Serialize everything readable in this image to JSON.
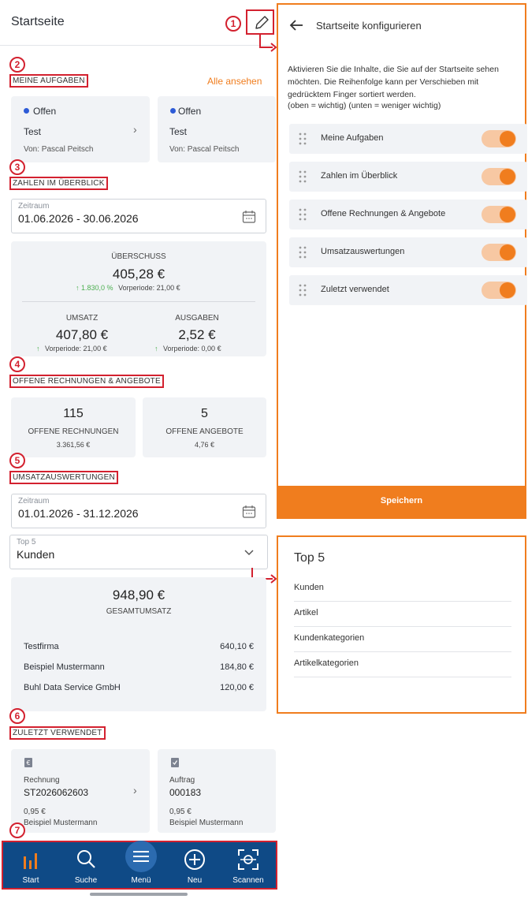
{
  "header": {
    "title": "Startseite"
  },
  "badges": [
    "1",
    "2",
    "3",
    "4",
    "5",
    "6",
    "7"
  ],
  "tasks": {
    "title": "MEINE AUFGABEN",
    "link": "Alle ansehen",
    "cards": [
      {
        "status": "Offen",
        "name": "Test",
        "from": "Von: Pascal Peitsch"
      },
      {
        "status": "Offen",
        "name": "Test",
        "from": "Von: Pascal Peitsch"
      }
    ]
  },
  "overview": {
    "title": "ZAHLEN IM ÜBERBLICK",
    "period_label": "Zeitraum",
    "period_value": "01.06.2026 - 30.06.2026",
    "surplus_label": "ÜBERSCHUSS",
    "surplus_value": "405,28 €",
    "surplus_change": "1.830,0 %",
    "surplus_prev": "Vorperiode: 21,00 €",
    "revenue_label": "UMSATZ",
    "revenue_value": "407,80 €",
    "revenue_prev": "Vorperiode: 21,00 €",
    "expenses_label": "AUSGABEN",
    "expenses_value": "2,52 €",
    "expenses_prev": "Vorperiode: 0,00 €"
  },
  "open_items": {
    "title": "OFFENE RECHNUNGEN & ANGEBOTE",
    "invoices_count": "115",
    "invoices_label": "OFFENE RECHNUNGEN",
    "invoices_sum": "3.361,56 €",
    "offers_count": "5",
    "offers_label": "OFFENE ANGEBOTE",
    "offers_sum": "4,76 €"
  },
  "sales": {
    "title": "UMSATZAUSWERTUNGEN",
    "period_label": "Zeitraum",
    "period_value": "01.01.2026 - 31.12.2026",
    "top_label": "Top 5",
    "top_value": "Kunden",
    "total_value": "948,90 €",
    "total_label": "GESAMTUMSATZ",
    "rows": [
      {
        "name": "Testfirma",
        "amount": "640,10 €"
      },
      {
        "name": "Beispiel Mustermann",
        "amount": "184,80 €"
      },
      {
        "name": "Buhl Data Service GmbH",
        "amount": "120,00 €"
      }
    ]
  },
  "recent": {
    "title": "ZULETZT VERWENDET",
    "cards": [
      {
        "type": "Rechnung",
        "number": "ST2026062603",
        "amount": "0,95 €",
        "customer": "Beispiel Mustermann"
      },
      {
        "type": "Auftrag",
        "number": "000183",
        "amount": "0,95 €",
        "customer": "Beispiel Mustermann"
      }
    ]
  },
  "bottom_nav": {
    "items": [
      {
        "label": "Start"
      },
      {
        "label": "Suche"
      },
      {
        "label": "Menü"
      },
      {
        "label": "Neu"
      },
      {
        "label": "Scannen"
      }
    ]
  },
  "config_panel": {
    "title": "Startseite konfigurieren",
    "description": "Aktivieren Sie die Inhalte, die Sie auf der Startseite sehen möchten. Die Reihenfolge kann per Verschieben mit gedrücktem Finger sortiert werden.",
    "hint": "(oben = wichtig) (unten = weniger wichtig)",
    "toggles": [
      {
        "label": "Meine Aufgaben",
        "on": true
      },
      {
        "label": "Zahlen im Überblick",
        "on": true
      },
      {
        "label": "Offene Rechnungen & Angebote",
        "on": true
      },
      {
        "label": "Umsatzauswertungen",
        "on": true
      },
      {
        "label": "Zuletzt verwendet",
        "on": true
      }
    ],
    "save_label": "Speichern"
  },
  "top5_panel": {
    "title": "Top 5",
    "options": [
      "Kunden",
      "Artikel",
      "Kundenkategorien",
      "Artikelkategorien"
    ]
  },
  "colors": {
    "accent": "#f07d1e",
    "highlight": "#d3212f",
    "nav": "#0f4a86",
    "positive": "#4caf50",
    "status_dot": "#2d5bd7"
  }
}
